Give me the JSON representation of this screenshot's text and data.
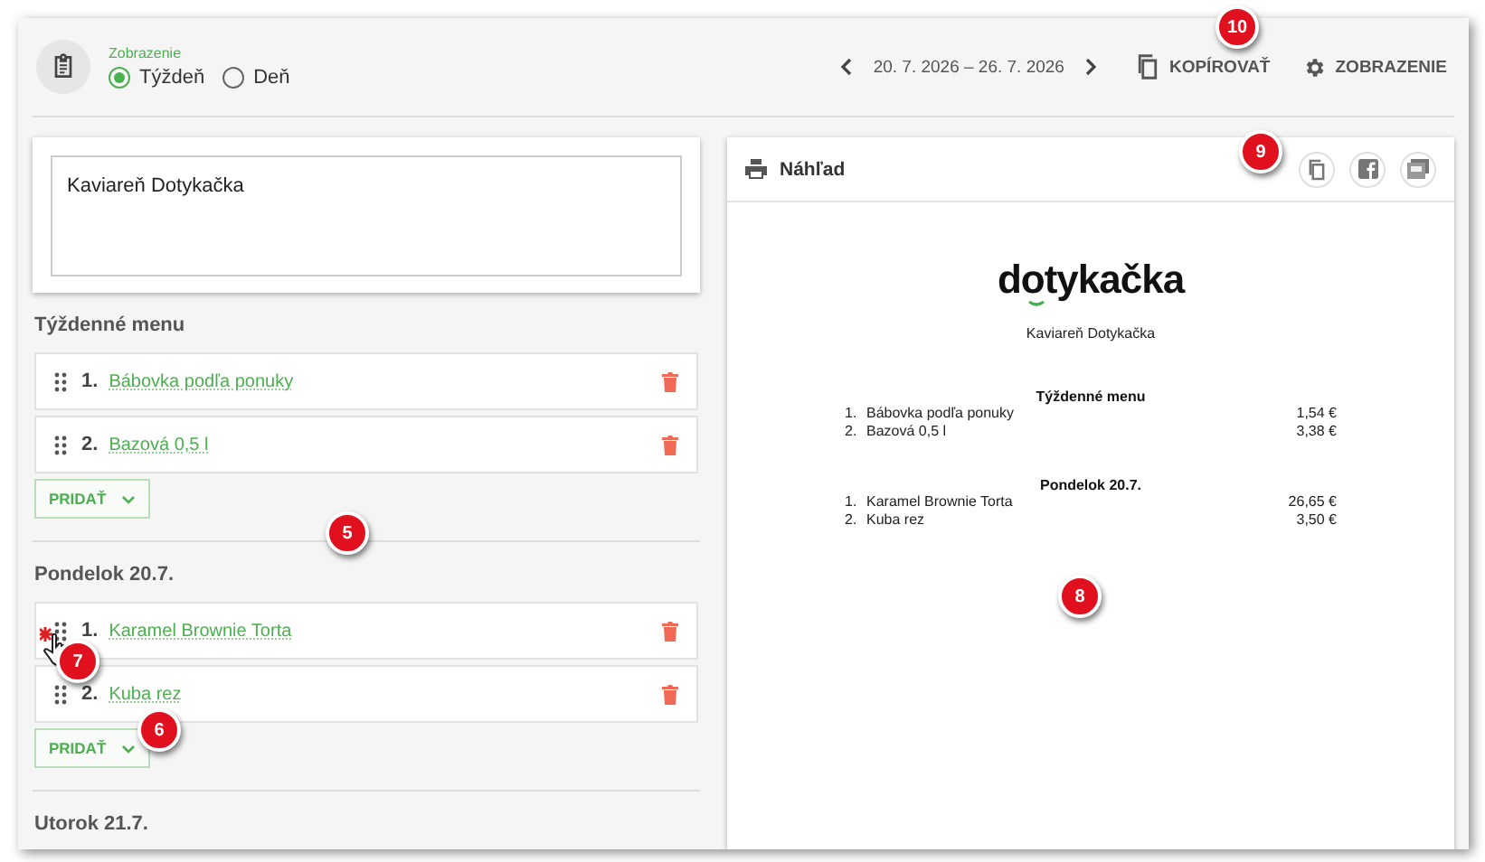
{
  "view": {
    "label": "Zobrazenie",
    "options": [
      {
        "label": "Týždeň",
        "selected": true
      },
      {
        "label": "Deň",
        "selected": false
      }
    ]
  },
  "toolbar": {
    "date_range": "20. 7. 2026 – 26. 7. 2026",
    "copy_button": "KOPÍROVAŤ",
    "view_button": "ZOBRAZENIE"
  },
  "title_field": {
    "value": "Kaviareň Dotykačka"
  },
  "sections": [
    {
      "title": "Týždenné menu",
      "items": [
        {
          "number": "1.",
          "name": "Bábovka podľa ponuky"
        },
        {
          "number": "2.",
          "name": "Bazová 0,5 l"
        }
      ],
      "add_button": "PRIDAŤ"
    },
    {
      "title": "Pondelok 20.7.",
      "items": [
        {
          "number": "1.",
          "name": "Karamel Brownie Torta"
        },
        {
          "number": "2.",
          "name": "Kuba rez"
        }
      ],
      "add_button": "PRIDAŤ"
    },
    {
      "title": "Utorok 21.7."
    }
  ],
  "preview": {
    "title": "Náhľad",
    "logo": "dotykačka",
    "venue": "Kaviareň Dotykačka",
    "groups": [
      {
        "title": "Týždenné menu",
        "items": [
          {
            "number": "1.",
            "name": "Bábovka podľa ponuky",
            "price": "1,54 €"
          },
          {
            "number": "2.",
            "name": "Bazová 0,5 l",
            "price": "3,38 €"
          }
        ]
      },
      {
        "title": "Pondelok 20.7.",
        "items": [
          {
            "number": "1.",
            "name": "Karamel Brownie Torta",
            "price": "26,65 €"
          },
          {
            "number": "2.",
            "name": "Kuba rez",
            "price": "3,50 €"
          }
        ]
      }
    ]
  },
  "callouts": [
    "10",
    "9",
    "5",
    "6",
    "7",
    "8"
  ]
}
